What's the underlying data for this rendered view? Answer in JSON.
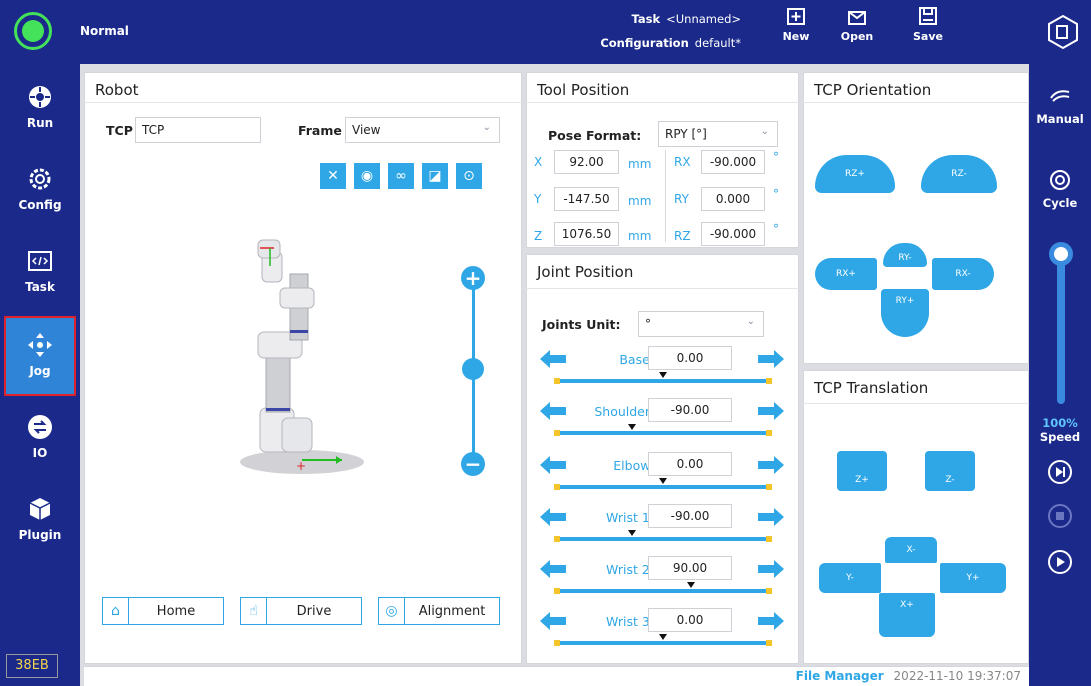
{
  "header": {
    "mode": "Normal",
    "task_label": "Task",
    "task_value": "<Unnamed>",
    "configuration_label": "Configuration",
    "configuration_value": "default*",
    "buttons": {
      "new": "New",
      "open": "Open",
      "save": "Save"
    }
  },
  "sidebar": {
    "items": [
      {
        "label": "Run",
        "icon": "run-icon"
      },
      {
        "label": "Config",
        "icon": "gear-icon"
      },
      {
        "label": "Task",
        "icon": "code-icon"
      },
      {
        "label": "Jog",
        "icon": "move-arrows-icon"
      },
      {
        "label": "IO",
        "icon": "io-icon"
      },
      {
        "label": "Plugin",
        "icon": "cube-icon"
      }
    ],
    "active": "Jog",
    "version": "38EB",
    "colors": {
      "active_bg": "#2f84d8",
      "active_border": "#e0222a"
    }
  },
  "rightbar": {
    "manual": "Manual",
    "cycle": "Cycle",
    "speed_percent": "100%",
    "speed_label": "Speed",
    "speed_value": 100
  },
  "robot": {
    "title": "Robot",
    "tcp_label": "TCP",
    "tcp_value": "TCP",
    "frame_label": "Frame",
    "frame_value": "View",
    "tools": [
      "wrench-icon",
      "eye-icon",
      "link-icon",
      "eraser-icon",
      "target-icon"
    ],
    "buttons": {
      "home": "Home",
      "drive": "Drive",
      "alignment": "Alignment"
    }
  },
  "tool_position": {
    "title": "Tool Position",
    "pose_format_label": "Pose Format:",
    "pose_format_value": "RPY [°]",
    "rows": [
      {
        "axis": "X",
        "value": "92.00",
        "unit": "mm",
        "raxis": "RX",
        "rvalue": "-90.000",
        "runit": "°"
      },
      {
        "axis": "Y",
        "value": "-147.50",
        "unit": "mm",
        "raxis": "RY",
        "rvalue": "0.000",
        "runit": "°"
      },
      {
        "axis": "Z",
        "value": "1076.50",
        "unit": "mm",
        "raxis": "RZ",
        "rvalue": "-90.000",
        "runit": "°"
      }
    ]
  },
  "joint_position": {
    "title": "Joint Position",
    "unit_label": "Joints Unit:",
    "unit_value": "°",
    "joints": [
      {
        "name": "Base:",
        "value": "0.00",
        "pos": 0.5
      },
      {
        "name": "Shoulder:",
        "value": "-90.00",
        "pos": 0.36
      },
      {
        "name": "Elbow:",
        "value": "0.00",
        "pos": 0.5
      },
      {
        "name": "Wrist 1:",
        "value": "-90.00",
        "pos": 0.36
      },
      {
        "name": "Wrist 2:",
        "value": "90.00",
        "pos": 0.63
      },
      {
        "name": "Wrist 3:",
        "value": "0.00",
        "pos": 0.5
      }
    ]
  },
  "tcp_orientation": {
    "title": "TCP Orientation",
    "buttons": {
      "rz_plus": "RZ+",
      "rz_minus": "RZ-",
      "ry_minus": "RY-",
      "rx_plus": "RX+",
      "rx_minus": "RX-",
      "ry_plus": "RY+"
    }
  },
  "tcp_translation": {
    "title": "TCP Translation",
    "buttons": {
      "z_plus": "Z+",
      "z_minus": "Z-",
      "x_minus": "X-",
      "y_minus": "Y-",
      "y_plus": "Y+",
      "x_plus": "X+"
    }
  },
  "statusbar": {
    "file_manager": "File Manager",
    "timestamp": "2022-11-10 19:37:07"
  }
}
